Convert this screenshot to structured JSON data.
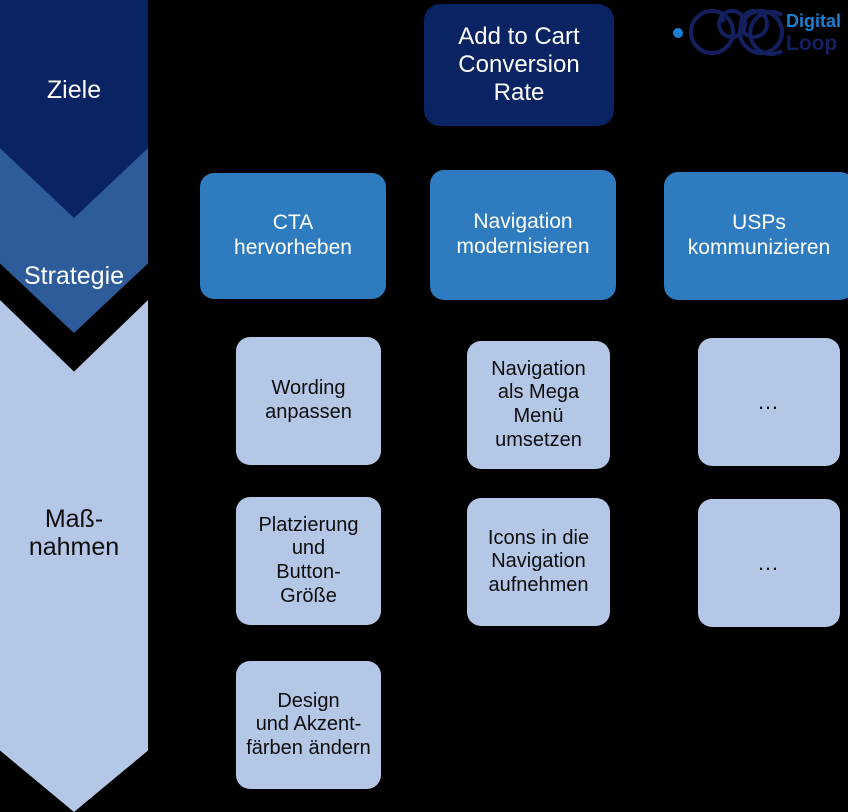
{
  "funnel": {
    "stages": [
      {
        "label": "Ziele",
        "color": "#0A2363"
      },
      {
        "label": "Strategie",
        "color": "#2E5C9A"
      },
      {
        "label": "Maß-\nnahmen",
        "color": "#B4C7E7"
      }
    ],
    "massnahmen_line1": "Maß-",
    "massnahmen_line2": "nahmen"
  },
  "goal": {
    "line1": "Add to Cart",
    "line2": "Conversion",
    "line3": "Rate",
    "color": "#0A2363"
  },
  "strategies": [
    {
      "line1": "CTA",
      "line2": "hervorheben"
    },
    {
      "line1": "Navigation",
      "line2": "modernisieren"
    },
    {
      "line1": "USPs",
      "line2": "kommunizieren"
    }
  ],
  "measures": {
    "column1": [
      {
        "lines": [
          "Wording",
          "anpassen"
        ]
      },
      {
        "lines": [
          "Platzierung",
          "und",
          "Button-",
          "Größe"
        ]
      },
      {
        "lines": [
          "Design",
          "und Akzent-",
          "färben ändern"
        ]
      }
    ],
    "column2": [
      {
        "lines": [
          "Navigation",
          "als Mega",
          "Menü",
          "umsetzen"
        ]
      },
      {
        "lines": [
          "Icons in die",
          "Navigation",
          "aufnehmen"
        ]
      }
    ],
    "column3": [
      {
        "lines": [
          "…"
        ]
      },
      {
        "lines": [
          "…"
        ]
      }
    ]
  },
  "logo": {
    "word1": "Digital",
    "word2": "Loop",
    "word1_color": "#1B7FD4",
    "word2_color": "#14205E",
    "ring_color": "#14205E",
    "dot_color": "#1B7FD4"
  },
  "palette": {
    "background": "#000000",
    "navy": "#0A2363",
    "mid_blue": "#2E5C9A",
    "strategy_blue": "#2E7CBF",
    "light_blue": "#B4C7E7",
    "white": "#FFFFFF",
    "black_text": "#0D0D0D"
  }
}
